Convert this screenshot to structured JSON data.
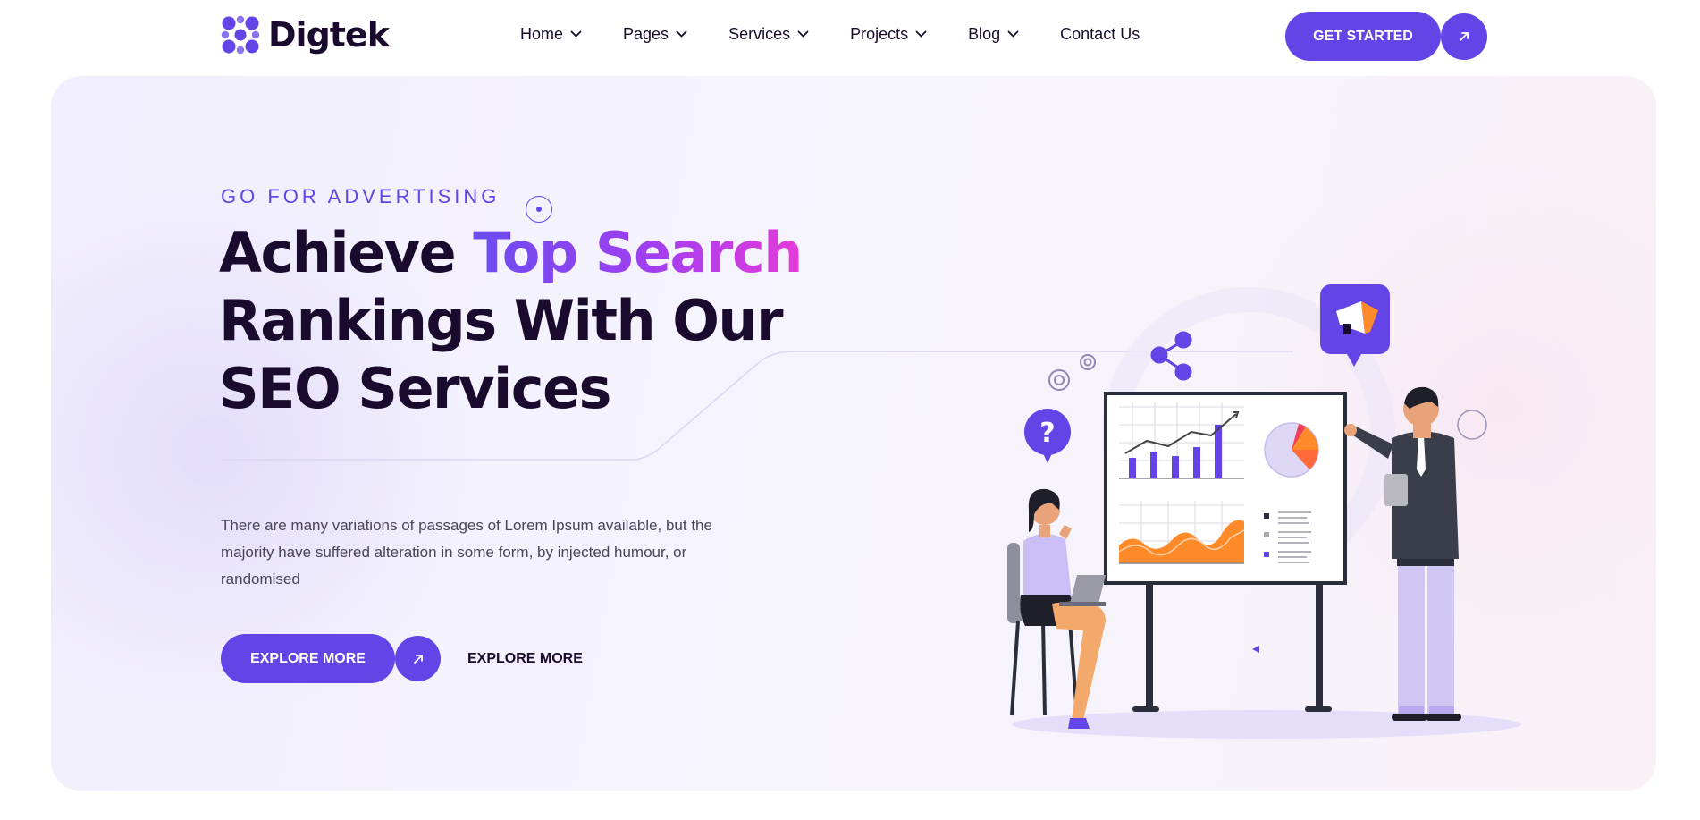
{
  "brand": {
    "name": "Digtek",
    "accent": "#6344e6",
    "dark": "#1a0b2e"
  },
  "nav": {
    "items": [
      {
        "label": "Home",
        "has_dropdown": true
      },
      {
        "label": "Pages",
        "has_dropdown": true
      },
      {
        "label": "Services",
        "has_dropdown": true
      },
      {
        "label": "Projects",
        "has_dropdown": true
      },
      {
        "label": "Blog",
        "has_dropdown": true
      },
      {
        "label": "Contact Us",
        "has_dropdown": false
      }
    ]
  },
  "header": {
    "cta_label": "GET STARTED",
    "cta_icon": "arrow-up-right-icon"
  },
  "hero": {
    "eyebrow": "GO FOR ADVERTISING",
    "headline_part1": "Achieve ",
    "headline_highlight": "Top Search",
    "headline_part2": "Rankings With Our SEO Services",
    "description": "There are many variations of passages of Lorem Ipsum available, but the majority have suffered alteration in some form, by injected humour, or randomised",
    "primary_button": "EXPLORE MORE",
    "secondary_link": "EXPLORE MORE",
    "illustration": "seo-presentation-illustration"
  }
}
